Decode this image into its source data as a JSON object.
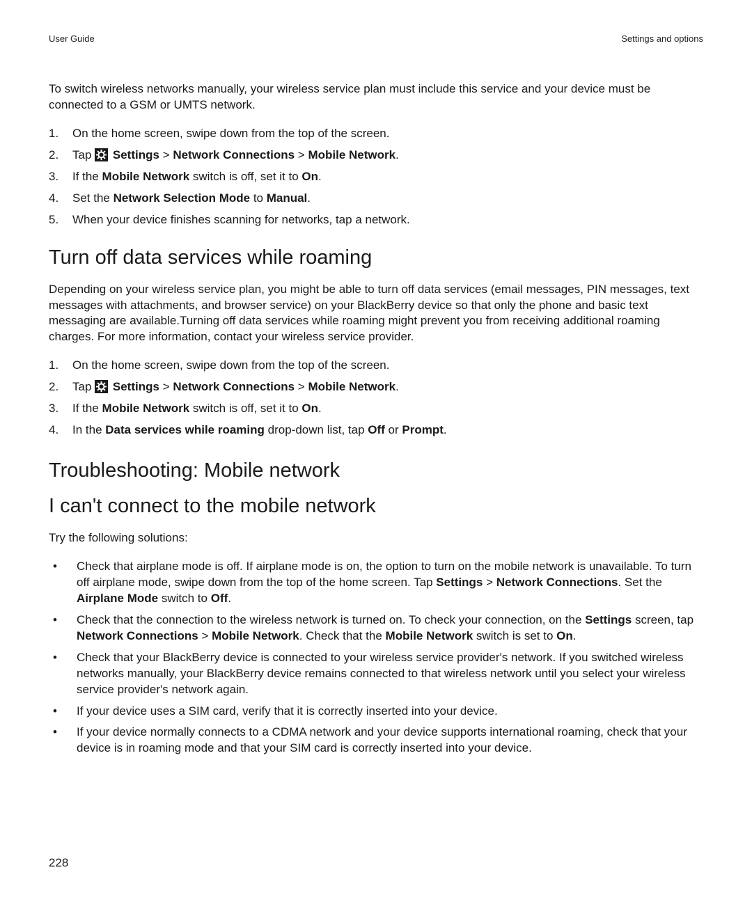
{
  "header": {
    "left": "User Guide",
    "right": "Settings and options"
  },
  "intro_paragraph": "To switch wireless networks manually, your wireless service plan must include this service and your device must be connected to a GSM or UMTS network.",
  "list1": {
    "i1": {
      "n": "1.",
      "t": "On the home screen, swipe down from the top of the screen."
    },
    "i2": {
      "n": "2.",
      "pre": "Tap ",
      "s1": "Settings",
      "sep1": " > ",
      "s2": "Network Connections",
      "sep2": " > ",
      "s3": "Mobile Network",
      "post": "."
    },
    "i3": {
      "n": "3.",
      "pre": "If the ",
      "b1": "Mobile Network",
      "mid": " switch is off, set it to ",
      "b2": "On",
      "post": "."
    },
    "i4": {
      "n": "4.",
      "pre": "Set the ",
      "b1": "Network Selection Mode",
      "mid": " to ",
      "b2": "Manual",
      "post": "."
    },
    "i5": {
      "n": "5.",
      "t": "When your device finishes scanning for networks, tap a network."
    }
  },
  "h_roaming": "Turn off data services while roaming",
  "roaming_paragraph": "Depending on your wireless service plan, you might be able to turn off data services (email messages, PIN messages, text messages with attachments, and browser service) on your BlackBerry device so that only the phone and basic text messaging are available.Turning off data services while roaming might prevent you from receiving additional roaming charges. For more information, contact your wireless service provider.",
  "list2": {
    "i1": {
      "n": "1.",
      "t": "On the home screen, swipe down from the top of the screen."
    },
    "i2": {
      "n": "2.",
      "pre": "Tap ",
      "s1": "Settings",
      "sep1": " > ",
      "s2": "Network Connections",
      "sep2": " > ",
      "s3": "Mobile Network",
      "post": "."
    },
    "i3": {
      "n": "3.",
      "pre": "If the ",
      "b1": "Mobile Network",
      "mid": " switch is off, set it to ",
      "b2": "On",
      "post": "."
    },
    "i4": {
      "n": "4.",
      "pre": "In the ",
      "b1": "Data services while roaming",
      "mid": " drop-down list, tap ",
      "b2": "Off",
      "mid2": " or ",
      "b3": "Prompt",
      "post": "."
    }
  },
  "h_troubleshoot": "Troubleshooting: Mobile network",
  "h_cant_connect": "I can't connect to the mobile network",
  "try_line": "Try the following solutions:",
  "bullets": {
    "b1": {
      "p1": "Check that airplane mode is off. If airplane mode is on, the option to turn on the mobile network is unavailable. To turn off airplane mode, swipe down from the top of the home screen. Tap ",
      "s1": "Settings",
      "sep1": " > ",
      "s2": "Network Connections",
      "p2": ". Set the ",
      "s3": "Airplane Mode",
      "p3": " switch to ",
      "s4": "Off",
      "p4": "."
    },
    "b2": {
      "p1": "Check that the connection to the wireless network is turned on. To check your connection, on the ",
      "s1": "Settings",
      "p2": " screen, tap ",
      "s2": "Network Connections",
      "sep1": " > ",
      "s3": "Mobile Network",
      "p3": ". Check that the ",
      "s4": "Mobile Network",
      "p4": " switch is set to ",
      "s5": "On",
      "p5": "."
    },
    "b3": {
      "t": "Check that your BlackBerry device is connected to your wireless service provider's network. If you switched wireless networks manually, your BlackBerry device remains connected to that wireless network until you select your wireless service provider's network again."
    },
    "b4": {
      "t": "If your device uses a SIM card, verify that it is correctly inserted into your device."
    },
    "b5": {
      "t": "If your device normally connects to a CDMA network and your device supports international roaming, check that your device is in roaming mode and that your SIM card is correctly inserted into your device."
    }
  },
  "page_number": "228",
  "icon": {
    "gear": "gear-icon"
  }
}
